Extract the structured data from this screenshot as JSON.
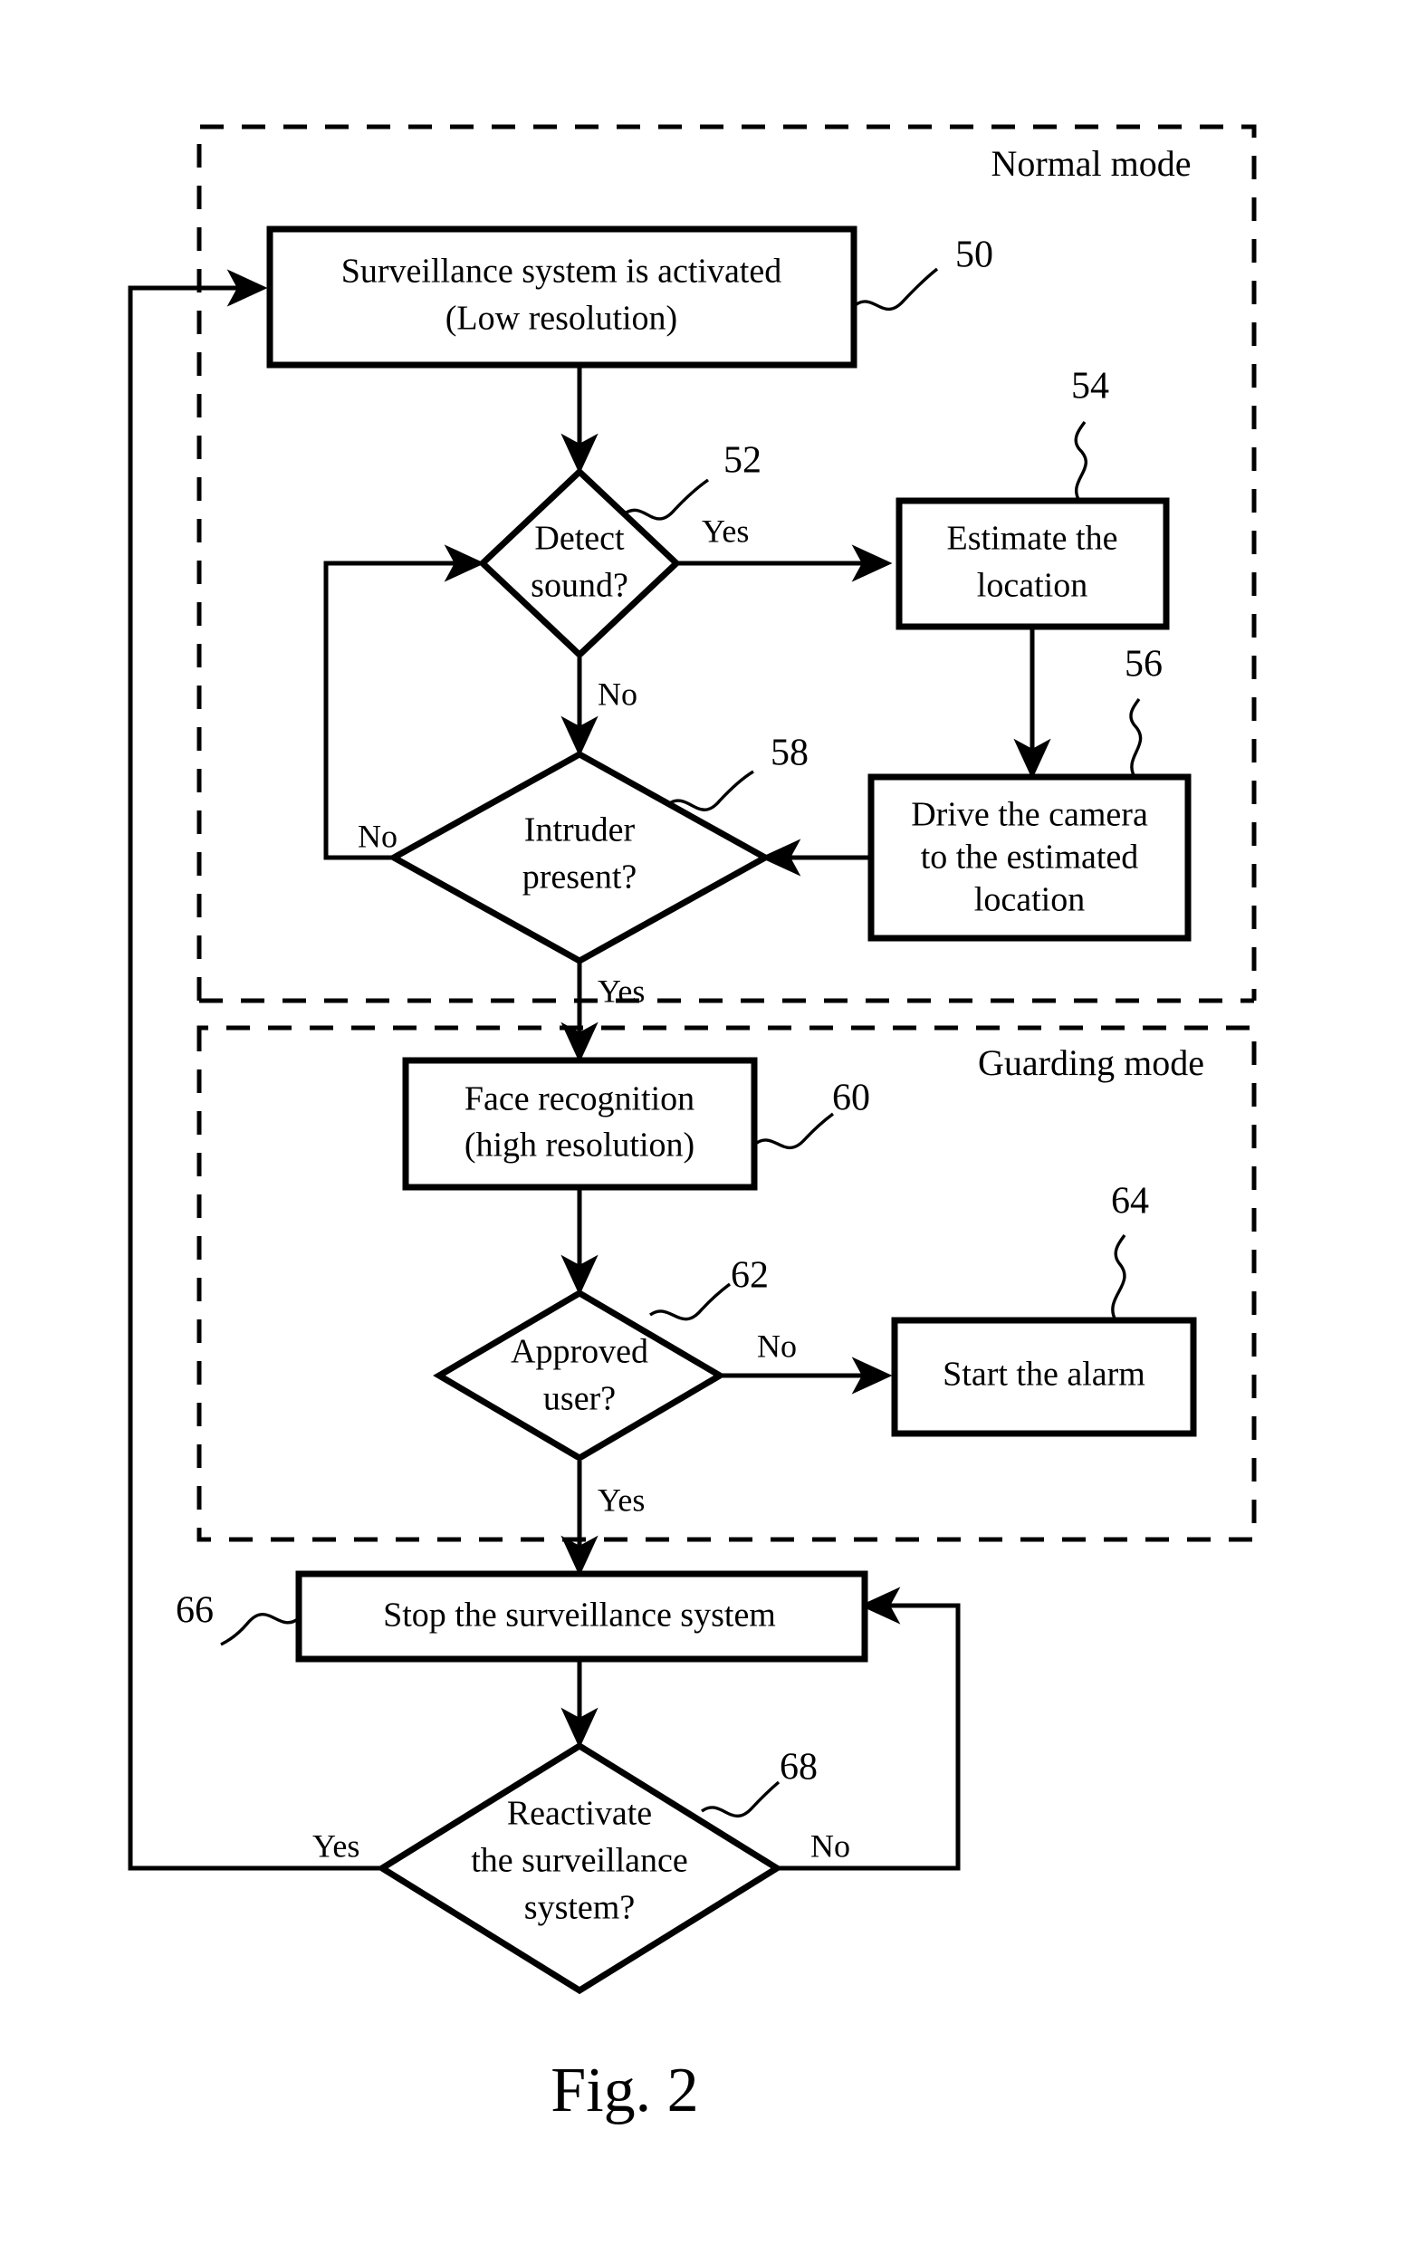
{
  "figure": {
    "caption": "Fig. 2",
    "regions": [
      {
        "id": "normal-mode",
        "label": "Normal mode"
      },
      {
        "id": "guarding-mode",
        "label": "Guarding mode"
      }
    ]
  },
  "nodes": [
    {
      "id": "activate",
      "shape": "rect",
      "ref": "50",
      "lines": [
        "Surveillance system is activated",
        "(Low resolution)"
      ]
    },
    {
      "id": "detect-sound",
      "shape": "diamond",
      "ref": "52",
      "lines": [
        "Detect",
        "sound?"
      ]
    },
    {
      "id": "estimate-location",
      "shape": "rect",
      "ref": "54",
      "lines": [
        "Estimate the",
        "location"
      ]
    },
    {
      "id": "drive-camera",
      "shape": "rect",
      "ref": "56",
      "lines": [
        "Drive the camera",
        "to the estimated",
        "location"
      ]
    },
    {
      "id": "intruder-present",
      "shape": "diamond",
      "ref": "58",
      "lines": [
        "Intruder",
        "present?"
      ]
    },
    {
      "id": "face-recognition",
      "shape": "rect",
      "ref": "60",
      "lines": [
        "Face recognition",
        "(high resolution)"
      ]
    },
    {
      "id": "approved-user",
      "shape": "diamond",
      "ref": "62",
      "lines": [
        "Approved",
        "user?"
      ]
    },
    {
      "id": "start-alarm",
      "shape": "rect",
      "ref": "64",
      "lines": [
        "Start the alarm"
      ]
    },
    {
      "id": "stop-surveillance",
      "shape": "rect",
      "ref": "66",
      "lines": [
        "Stop the surveillance system"
      ]
    },
    {
      "id": "reactivate",
      "shape": "diamond",
      "ref": "68",
      "lines": [
        "Reactivate",
        "the surveillance",
        "system?"
      ]
    }
  ],
  "branch_labels": {
    "detect_sound_yes": "Yes",
    "detect_sound_no": "No",
    "intruder_no": "No",
    "intruder_yes": "Yes",
    "approved_no": "No",
    "approved_yes": "Yes",
    "reactivate_yes": "Yes",
    "reactivate_no": "No"
  },
  "colors": {
    "stroke": "#000000",
    "fill": "#ffffff"
  }
}
